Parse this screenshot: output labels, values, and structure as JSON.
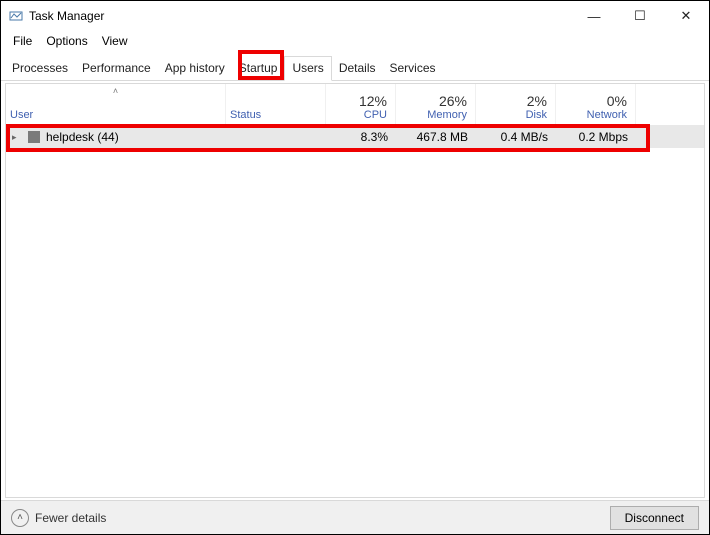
{
  "window": {
    "title": "Task Manager",
    "controls": {
      "min": "—",
      "max": "☐",
      "close": "✕"
    }
  },
  "menubar": [
    "File",
    "Options",
    "View"
  ],
  "tabs": [
    "Processes",
    "Performance",
    "App history",
    "Startup",
    "Users",
    "Details",
    "Services"
  ],
  "active_tab_index": 4,
  "columns": {
    "user": {
      "label": "User"
    },
    "status": {
      "label": "Status"
    },
    "cpu": {
      "pct": "12%",
      "label": "CPU"
    },
    "memory": {
      "pct": "26%",
      "label": "Memory"
    },
    "disk": {
      "pct": "2%",
      "label": "Disk"
    },
    "network": {
      "pct": "0%",
      "label": "Network"
    }
  },
  "rows": [
    {
      "user": "helpdesk (44)",
      "status": "",
      "cpu": "8.3%",
      "memory": "467.8 MB",
      "disk": "0.4 MB/s",
      "network": "0.2 Mbps"
    }
  ],
  "footer": {
    "fewer_label": "Fewer details",
    "disconnect_label": "Disconnect"
  },
  "col_widths": {
    "user": 220,
    "status": 100,
    "cpu": 70,
    "memory": 80,
    "disk": 80,
    "network": 80
  }
}
